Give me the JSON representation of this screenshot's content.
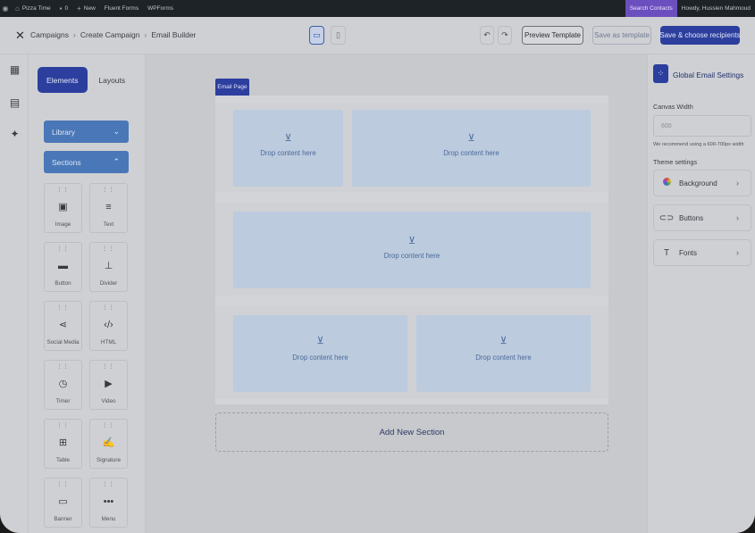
{
  "admin_bar": {
    "site_name": "Pizza Time",
    "comments_count": "0",
    "new_label": "New",
    "links": [
      "Fluent Forms",
      "WPForms"
    ],
    "search_label": "Search Contacts",
    "greeting": "Howdy, Hussien Mahmoud"
  },
  "header": {
    "breadcrumbs": [
      "Campaigns",
      "Create Campaign",
      "Email Builder"
    ],
    "preview_label": "Preview Template",
    "save_template_label": "Save as template",
    "save_recipients_label": "Save & choose recipients"
  },
  "left_panel": {
    "tabs": [
      "Elements",
      "Layouts"
    ],
    "library_label": "Library",
    "sections_label": "Sections",
    "elements": [
      {
        "label": "Image",
        "icon": "image-icon"
      },
      {
        "label": "Text",
        "icon": "text-icon"
      },
      {
        "label": "Button",
        "icon": "button-icon"
      },
      {
        "label": "Divider",
        "icon": "divider-icon"
      },
      {
        "label": "Social Media",
        "icon": "share-icon"
      },
      {
        "label": "HTML",
        "icon": "code-icon"
      },
      {
        "label": "Timer",
        "icon": "timer-icon"
      },
      {
        "label": "Video",
        "icon": "video-icon"
      },
      {
        "label": "Table",
        "icon": "table-icon"
      },
      {
        "label": "Signature",
        "icon": "signature-icon"
      },
      {
        "label": "Banner",
        "icon": "banner-icon"
      },
      {
        "label": "Menu",
        "icon": "menu-icon"
      }
    ]
  },
  "canvas": {
    "page_tag": "Email Page",
    "drop_label": "Drop content here",
    "add_section_label": "Add New Section"
  },
  "right_panel": {
    "title": "Global Email Settings",
    "canvas_width_label": "Canvas Width",
    "canvas_width_value": "600",
    "canvas_width_hint": "We recommend using a 600-700px width",
    "theme_settings_label": "Theme settings",
    "theme_items": [
      "Background",
      "Buttons",
      "Fonts"
    ]
  }
}
